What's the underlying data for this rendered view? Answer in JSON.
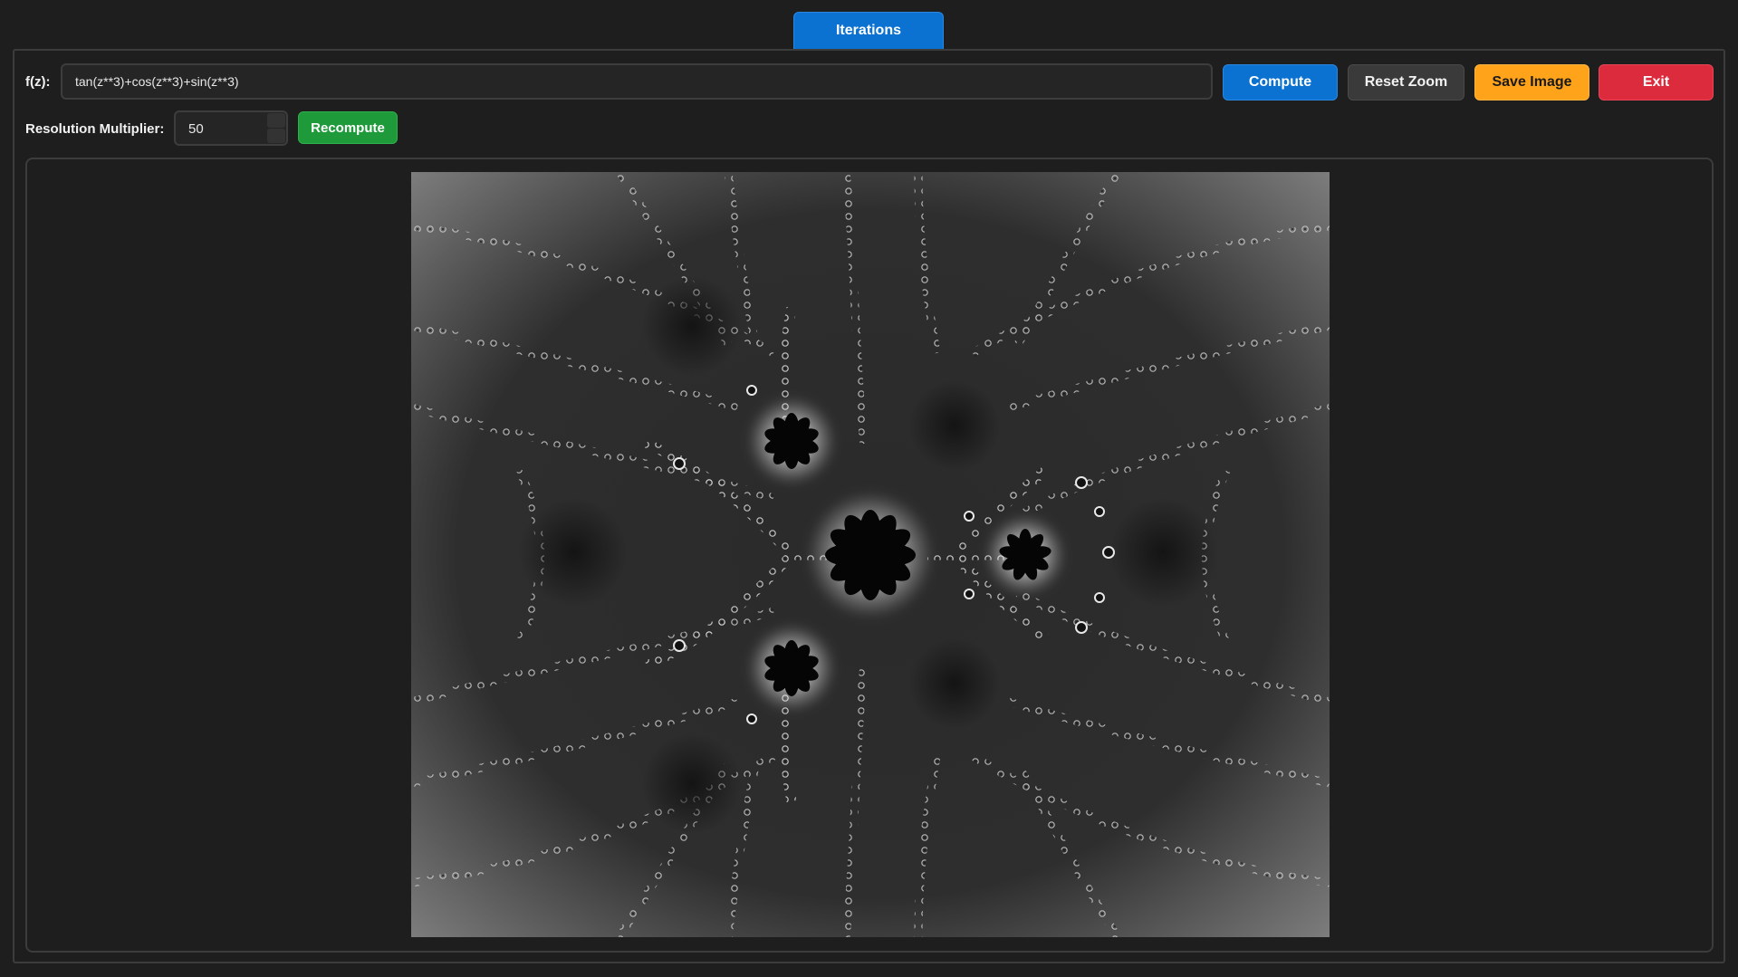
{
  "tabs": [
    {
      "label": "Iterations",
      "active": true
    }
  ],
  "formula": {
    "label": "f(z):",
    "value": "tan(z**3)+cos(z**3)+sin(z**3)"
  },
  "toolbar": {
    "compute_label": "Compute",
    "reset_zoom_label": "Reset Zoom",
    "save_image_label": "Save Image",
    "exit_label": "Exit"
  },
  "resolution": {
    "label": "Resolution Multiplier:",
    "value": "50",
    "recompute_label": "Recompute"
  },
  "colors": {
    "accent_blue": "#0b72d2",
    "save_orange": "#ffa31a",
    "exit_red": "#dc2b3c",
    "recompute_green": "#1f9a3a",
    "background": "#1e1e1e"
  }
}
